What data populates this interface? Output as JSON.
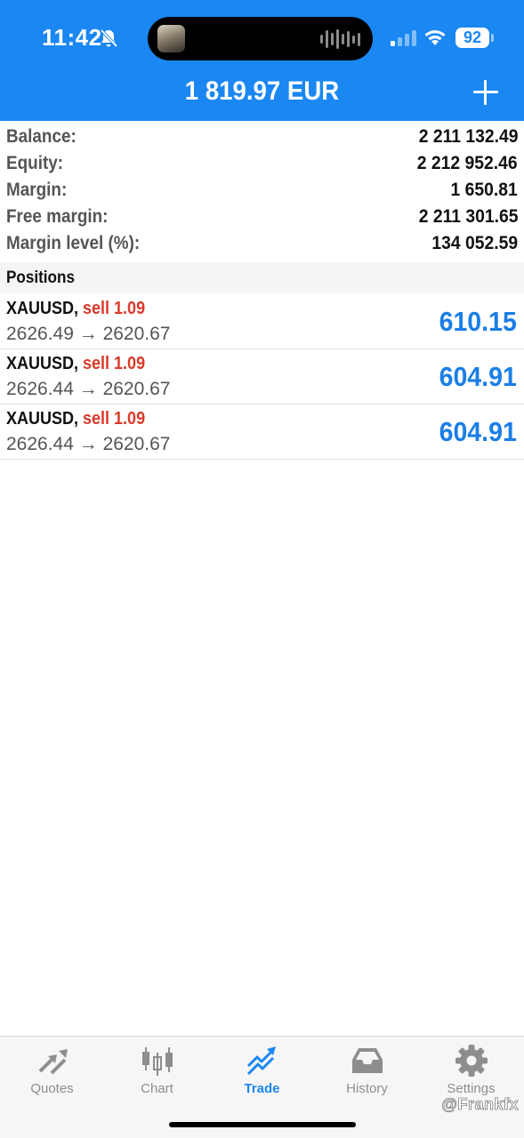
{
  "status_bar": {
    "time": "11:42",
    "battery": "92",
    "icons": [
      "bell-slash-icon",
      "signal-icon",
      "wifi-icon",
      "battery-icon"
    ]
  },
  "header": {
    "title": "1 819.97 EUR",
    "add_icon": "plus-icon"
  },
  "summary": [
    {
      "label": "Balance:",
      "value": "2 211 132.49"
    },
    {
      "label": "Equity:",
      "value": "2 212 952.46"
    },
    {
      "label": "Margin:",
      "value": "1 650.81"
    },
    {
      "label": "Free margin:",
      "value": "2 211 301.65"
    },
    {
      "label": "Margin level (%):",
      "value": "134 052.59"
    }
  ],
  "positions": {
    "title": "Positions",
    "items": [
      {
        "symbol": "XAUUSD,",
        "side": "sell 1.09",
        "prices": "2626.49 → 2620.67",
        "profit": "610.15"
      },
      {
        "symbol": "XAUUSD,",
        "side": "sell 1.09",
        "prices": "2626.44 → 2620.67",
        "profit": "604.91"
      },
      {
        "symbol": "XAUUSD,",
        "side": "sell 1.09",
        "prices": "2626.44 → 2620.67",
        "profit": "604.91"
      }
    ]
  },
  "tabbar": {
    "tabs": [
      {
        "label": "Quotes",
        "icon": "quotes-arrows-icon"
      },
      {
        "label": "Chart",
        "icon": "candlestick-icon"
      },
      {
        "label": "Trade",
        "icon": "trade-trend-icon",
        "active": true
      },
      {
        "label": "History",
        "icon": "inbox-tray-icon"
      },
      {
        "label": "Settings",
        "icon": "gear-icon"
      }
    ]
  },
  "watermark": "@Frankfx",
  "colors": {
    "accent": "#1a87f2",
    "sell": "#d93a2b",
    "profit": "#1a7ee6"
  }
}
